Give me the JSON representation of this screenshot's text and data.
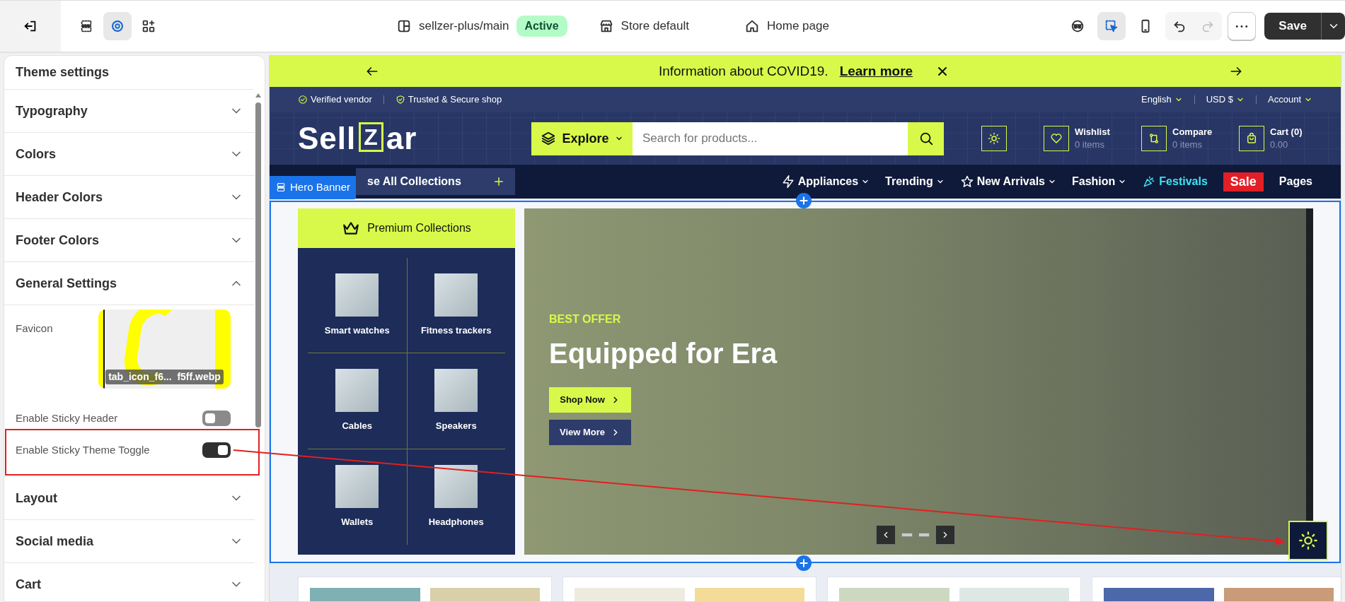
{
  "toolbar": {
    "left_buttons": [
      {
        "kind": "exit",
        "selected": false
      },
      {
        "kind": "sections",
        "selected": false
      },
      {
        "kind": "settings",
        "selected": true
      },
      {
        "kind": "blocks",
        "selected": false
      }
    ],
    "theme_name": "sellzer-plus/main",
    "theme_status": "Active",
    "store": "Store default",
    "page": "Home page",
    "right_buttons": [
      {
        "kind": "incognito",
        "selected": false,
        "disabled": false
      },
      {
        "kind": "select",
        "selected": true,
        "disabled": false
      },
      {
        "kind": "mobile",
        "selected": false,
        "disabled": false
      },
      {
        "kind": "undo",
        "selected": false,
        "disabled": false
      },
      {
        "kind": "redo",
        "selected": false,
        "disabled": true
      },
      {
        "kind": "more",
        "selected": false,
        "disabled": false
      }
    ],
    "save": "Save"
  },
  "sidebar": {
    "title": "Theme settings",
    "sections": [
      {
        "label": "Typography",
        "expanded": false
      },
      {
        "label": "Colors",
        "expanded": false
      },
      {
        "label": "Header Colors",
        "expanded": false
      },
      {
        "label": "Footer Colors",
        "expanded": false
      },
      {
        "label": "General Settings",
        "expanded": true,
        "fields": [
          {
            "kind": "image",
            "label": "Favicon",
            "file_name": "tab_icon_f6...  f5ff.webp"
          },
          {
            "kind": "toggle",
            "label": "Enable Sticky Header",
            "on": false,
            "highlighted": false
          },
          {
            "kind": "toggle",
            "label": "Enable Sticky Theme Toggle",
            "on": true,
            "highlighted": true
          }
        ]
      },
      {
        "label": "Layout",
        "expanded": false
      },
      {
        "label": "Social media",
        "expanded": false
      },
      {
        "label": "Cart",
        "expanded": false
      }
    ]
  },
  "preview": {
    "announcement": {
      "text": "Information about COVID19.",
      "link": "Learn more"
    },
    "top_strip": {
      "badges": [
        {
          "kind": "check",
          "label": "Verified vendor"
        },
        {
          "kind": "shield",
          "label": "Trusted & Secure shop"
        }
      ],
      "menus": [
        "English",
        "USD $",
        "Account"
      ]
    },
    "header": {
      "logo": {
        "before": "Sell",
        "boxed": "Z",
        "after": "ar"
      },
      "explore": "Explore",
      "search_placeholder": "Search for products...",
      "actions": [
        {
          "kind": "theme"
        },
        {
          "kind": "wishlist",
          "label": "Wishlist",
          "sub": "0 items"
        },
        {
          "kind": "compare",
          "label": "Compare",
          "sub": "0 items"
        },
        {
          "kind": "cart",
          "label": "Cart (0)",
          "sub": "0.00"
        }
      ]
    },
    "nav": {
      "browse": "se All Collections",
      "items": [
        {
          "kind": "dropdown",
          "label": "Appliances"
        },
        {
          "kind": "dropdown",
          "label": "Trending"
        },
        {
          "kind": "dropdown",
          "label": "New Arrivals"
        },
        {
          "kind": "dropdown",
          "label": "Fashion"
        },
        {
          "kind": "highlight",
          "label": "Festivals"
        },
        {
          "kind": "badge",
          "label": "Sale"
        },
        {
          "kind": "link",
          "label": "Pages"
        }
      ]
    },
    "section_label": "Hero Banner",
    "hero": {
      "collections_title": "Premium Collections",
      "categories": [
        "Smart watches",
        "Fitness trackers",
        "Cables",
        "Speakers",
        "Wallets",
        "Headphones"
      ],
      "eyebrow": "BEST OFFER",
      "title": "Equipped for Era",
      "buttons": [
        {
          "kind": "primary",
          "label": "Shop Now"
        },
        {
          "kind": "secondary",
          "label": "View More"
        }
      ]
    }
  }
}
